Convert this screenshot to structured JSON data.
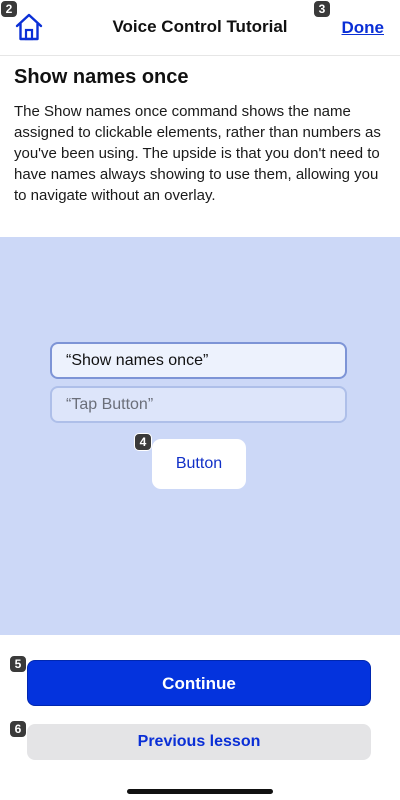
{
  "header": {
    "title": "Voice Control Tutorial",
    "done_label": "Done",
    "home_icon": "house-icon"
  },
  "badges": {
    "home": "2",
    "done": "3",
    "demo_button": "4",
    "continue": "5",
    "previous": "6"
  },
  "lesson": {
    "heading": "Show names once",
    "description": "The Show names once command shows the name assigned to clickable elements, rather than numbers as you've been using. The upside is that you don't need to have names always showing to use them, allowing you to navigate without an overlay."
  },
  "demo": {
    "command_active": "“Show names once”",
    "command_next": "“Tap Button”",
    "button_label": "Button"
  },
  "footer": {
    "continue_label": "Continue",
    "previous_label": "Previous lesson"
  },
  "colors": {
    "accent": "#0433dd",
    "link": "#0a2fd6",
    "demo_background": "#ccd8f7"
  }
}
